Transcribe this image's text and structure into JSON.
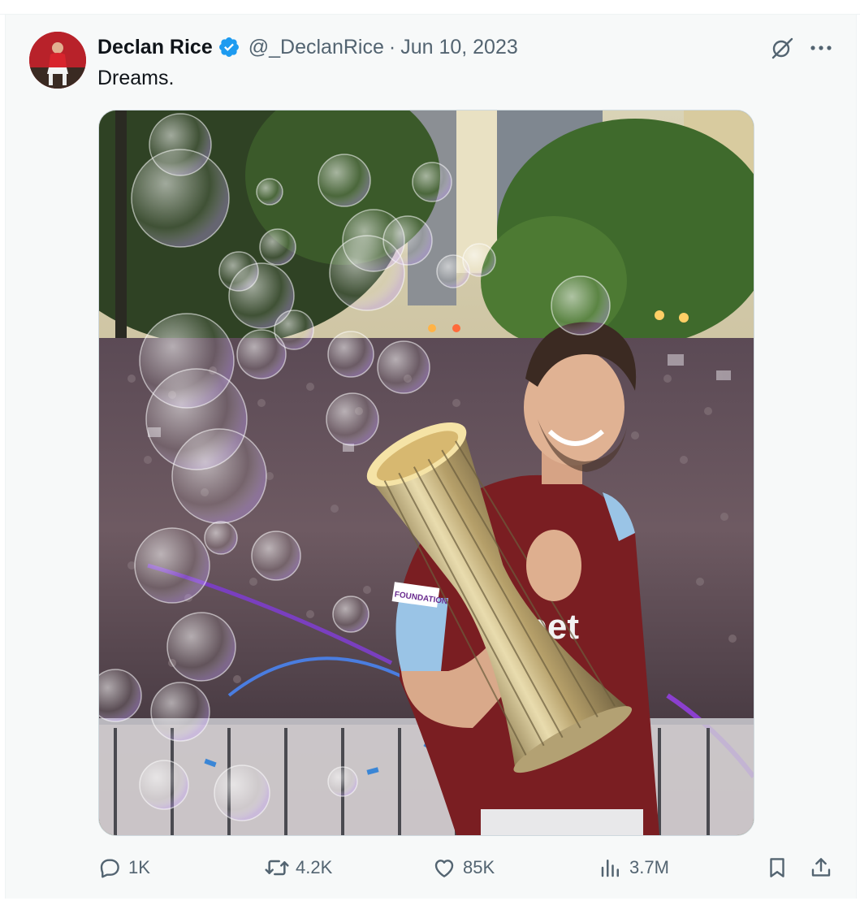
{
  "tweet": {
    "author_name": "Declan Rice",
    "handle": "@_DeclanRice",
    "separator": "·",
    "date": "Jun 10, 2023",
    "text": "Dreams."
  },
  "media": {
    "kit_sponsor_text": "bet",
    "patch_text": "FOUNDATION"
  },
  "actions": {
    "replies": "1K",
    "reposts": "4.2K",
    "likes": "85K",
    "views": "3.7M"
  },
  "icons": {
    "verified": "verified-badge-icon",
    "grok": "grok-icon",
    "more": "more-icon",
    "reply": "reply-icon",
    "repost": "repost-icon",
    "like": "heart-icon",
    "views": "views-icon",
    "bookmark": "bookmark-icon",
    "share": "share-icon"
  },
  "colors": {
    "verified_blue": "#1d9bf0",
    "secondary_text": "#536471",
    "primary_text": "#0f1419",
    "background": "#f7f9f9"
  }
}
